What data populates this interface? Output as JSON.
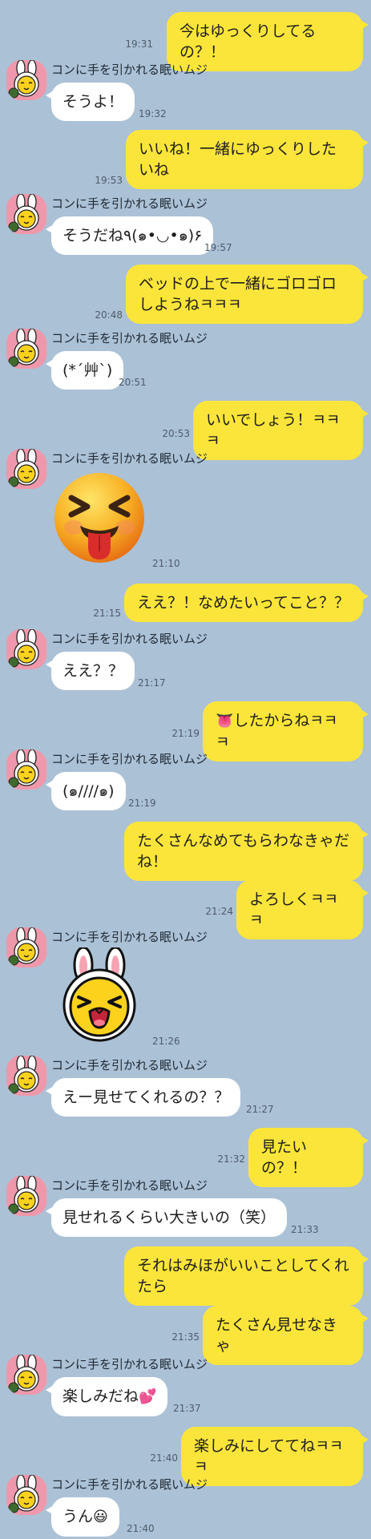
{
  "contact_name": "コンに手を引かれる眠いムジ",
  "messages": [
    {
      "dir": "out",
      "text": "今はゆっくりしてるの？！",
      "time": "19:31"
    },
    {
      "dir": "in",
      "text": "そうよ！",
      "time": "19:32"
    },
    {
      "dir": "out",
      "text": "いいね！一緒にゆっくりしたいね",
      "time": "19:53"
    },
    {
      "dir": "in",
      "text": "そうだね٩(๑•◡•๑)۶",
      "time": "19:57"
    },
    {
      "dir": "out",
      "text": "ベッドの上で一緒にゴロゴロしようねㅋㅋㅋ",
      "time": "20:48"
    },
    {
      "dir": "in",
      "text": "(*´艸`)",
      "time": "20:51"
    },
    {
      "dir": "out",
      "text": "いいでしょう！ㅋㅋㅋ",
      "time": "20:53"
    },
    {
      "dir": "in",
      "sticker": "tongue-face-emoji-sticker",
      "time": "21:10"
    },
    {
      "dir": "out",
      "text": "ええ？！なめたいってこと？？",
      "time": "21:15"
    },
    {
      "dir": "in",
      "text": "ええ？？",
      "time": "21:17"
    },
    {
      "dir": "out",
      "emoji": "tongue-emoji",
      "text": "したからねㅋㅋㅋ",
      "time": "21:19"
    },
    {
      "dir": "in",
      "text": "(๑////๑)",
      "time": "21:19"
    },
    {
      "dir": "out",
      "text": "たくさんなめてもらわなきゃだね！",
      "time": ""
    },
    {
      "dir": "out",
      "text": "よろしくㅋㅋㅋ",
      "time": "21:24"
    },
    {
      "dir": "in",
      "sticker": "muzi-bunny-laughing-sticker",
      "time": "21:26"
    },
    {
      "dir": "in",
      "text": "えー見せてくれるの？？",
      "time": "21:27"
    },
    {
      "dir": "out",
      "text": "見たいの？！",
      "time": "21:32"
    },
    {
      "dir": "in",
      "text": "見せれるくらい大きいの（笑）",
      "time": "21:33"
    },
    {
      "dir": "out",
      "text": "それはみほがいいことしてくれたら",
      "time": ""
    },
    {
      "dir": "out",
      "text": "たくさん見せなきゃ",
      "time": "21:35"
    },
    {
      "dir": "in",
      "text": "楽しみだね",
      "emoji": "two-hearts-emoji",
      "time": "21:37"
    },
    {
      "dir": "out",
      "text": "楽しみにしててねㅋㅋㅋ",
      "time": "21:40"
    },
    {
      "dir": "in",
      "text": "うん",
      "emoji": "grinning-face-emoji",
      "time": "21:40"
    }
  ],
  "colors": {
    "background": "#abc1d6",
    "outgoing_bubble": "#fbe53a",
    "incoming_bubble": "#ffffff",
    "avatar_bg": "#ef98ab"
  }
}
